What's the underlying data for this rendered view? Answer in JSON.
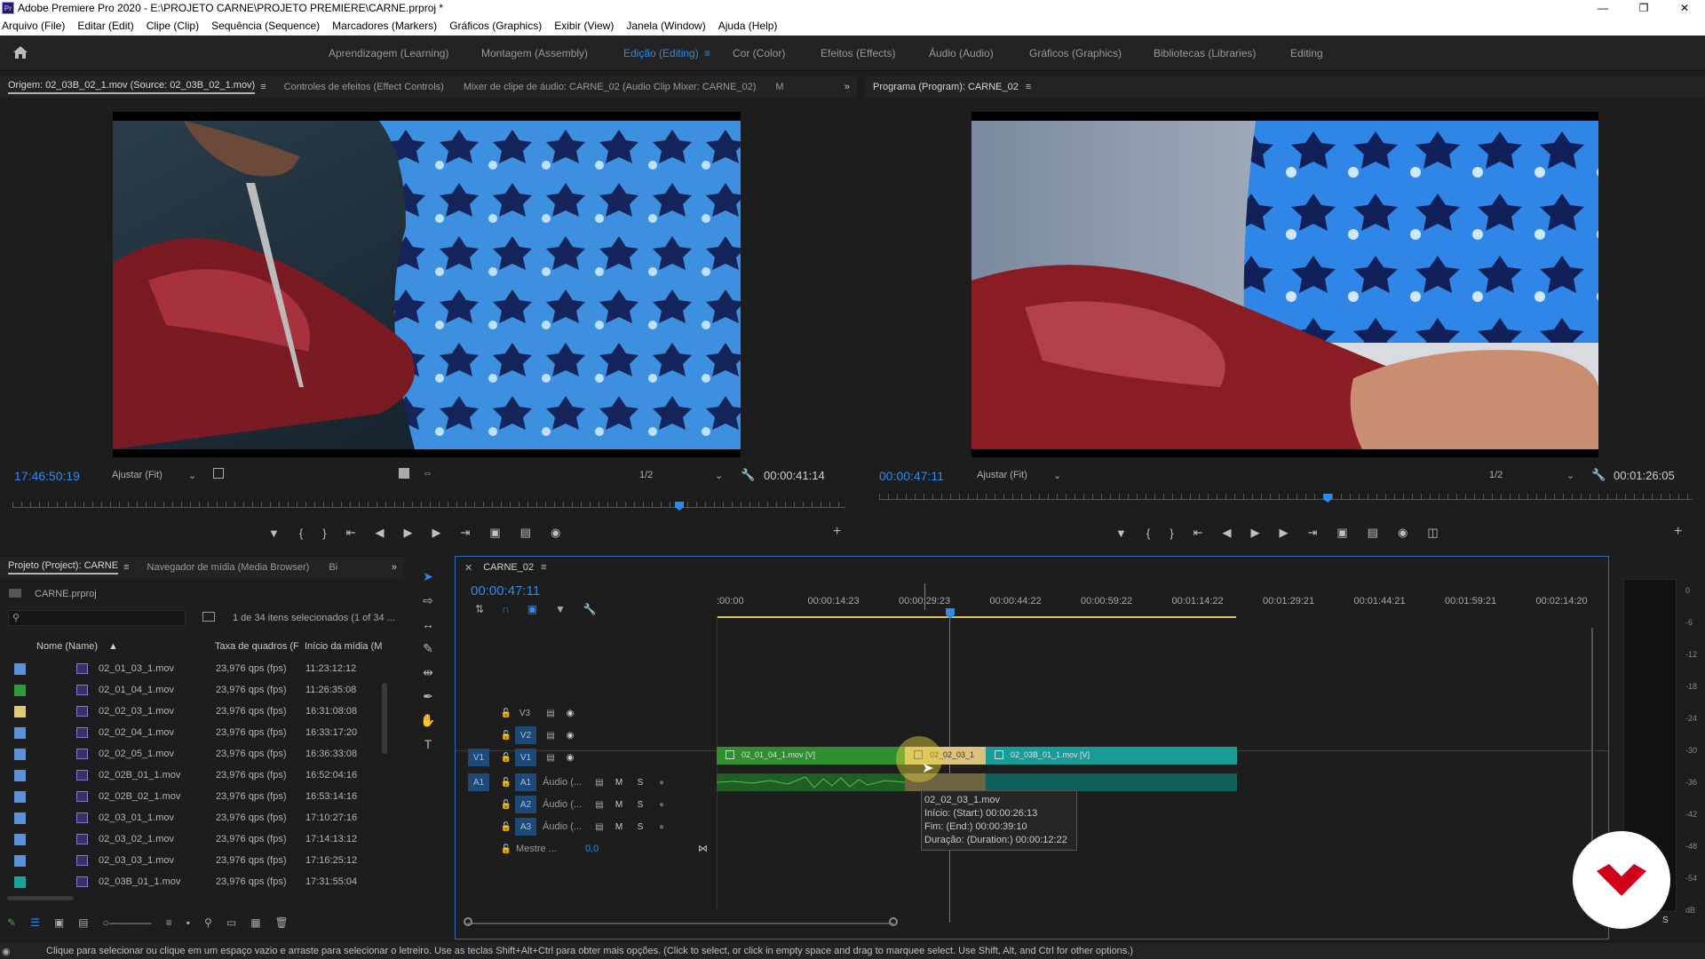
{
  "window": {
    "title": "Adobe Premiere Pro 2020 - E:\\PROJETO CARNE\\PROJETO PREMIERE\\CARNE.prproj *",
    "app_logo": "Pr"
  },
  "menu": [
    "Arquivo (File)",
    "Editar (Edit)",
    "Clipe (Clip)",
    "Sequência (Sequence)",
    "Marcadores (Markers)",
    "Gráficos (Graphics)",
    "Exibir (View)",
    "Janela (Window)",
    "Ajuda (Help)"
  ],
  "workspaces": [
    "Aprendizagem (Learning)",
    "Montagem (Assembly)",
    "Edição (Editing)",
    "Cor (Color)",
    "Efeitos (Effects)",
    "Áudio (Audio)",
    "Gráficos (Graphics)",
    "Bibliotecas (Libraries)",
    "Editing"
  ],
  "active_workspace": "Edição (Editing)",
  "source_panel": {
    "tabs": [
      "Origem: 02_03B_02_1.mov (Source: 02_03B_02_1.mov)",
      "Controles de efeitos (Effect Controls)",
      "Mixer de clipe de áudio: CARNE_02 (Audio Clip Mixer: CARNE_02)",
      "M"
    ],
    "timecode": "17:46:50:19",
    "fit": "Ajustar (Fit)",
    "resolution": "1/2",
    "duration": "00:00:41:14"
  },
  "program_panel": {
    "tab": "Programa (Program): CARNE_02",
    "timecode": "00:00:47:11",
    "fit": "Ajustar (Fit)",
    "resolution": "1/2",
    "duration": "00:01:26:05"
  },
  "project_panel": {
    "tabs": [
      "Projeto (Project): CARNE",
      "Navegador de mídia (Media Browser)",
      "Bi"
    ],
    "project_file": "CARNE.prproj",
    "selection_info": "1 de 34 itens selecionados (1 of 34 ...",
    "columns": [
      "Nome (Name)",
      "Taxa de quadros (F",
      "Início da mídia (M"
    ],
    "items": [
      {
        "color": "#5b8fd6",
        "name": "02_01_03_1.mov",
        "fps": "23,976 qps (fps)",
        "start": "11:23:12:12"
      },
      {
        "color": "#2f9a3a",
        "name": "02_01_04_1.mov",
        "fps": "23,976 qps (fps)",
        "start": "11:26:35:08"
      },
      {
        "color": "#e2c87a",
        "name": "02_02_03_1.mov",
        "fps": "23,976 qps (fps)",
        "start": "16:31:08:08"
      },
      {
        "color": "#5b8fd6",
        "name": "02_02_04_1.mov",
        "fps": "23,976 qps (fps)",
        "start": "16:33:17:20"
      },
      {
        "color": "#5b8fd6",
        "name": "02_02_05_1.mov",
        "fps": "23,976 qps (fps)",
        "start": "16:36:33:08"
      },
      {
        "color": "#5b8fd6",
        "name": "02_02B_01_1.mov",
        "fps": "23,976 qps (fps)",
        "start": "16:52:04:16"
      },
      {
        "color": "#5b8fd6",
        "name": "02_02B_02_1.mov",
        "fps": "23,976 qps (fps)",
        "start": "16:53:14:16"
      },
      {
        "color": "#5b8fd6",
        "name": "02_03_01_1.mov",
        "fps": "23,976 qps (fps)",
        "start": "17:10:27:16"
      },
      {
        "color": "#5b8fd6",
        "name": "02_03_02_1.mov",
        "fps": "23,976 qps (fps)",
        "start": "17:14:13:12"
      },
      {
        "color": "#5b8fd6",
        "name": "02_03_03_1.mov",
        "fps": "23,976 qps (fps)",
        "start": "17:16:25:12"
      },
      {
        "color": "#1aa39b",
        "name": "02_03B_01_1.mov",
        "fps": "23,976 qps (fps)",
        "start": "17:31:55:04"
      }
    ]
  },
  "timeline": {
    "tab": "CARNE_02",
    "timecode": "00:00:47:11",
    "ruler": [
      ":00:00",
      "00:00:14:23",
      "00:00:29:23",
      "00:00:44:22",
      "00:00:59:22",
      "00:01:14:22",
      "00:01:29:21",
      "00:01:44:21",
      "00:01:59:21",
      "00:02:14:20"
    ],
    "video_tracks": [
      "V3",
      "V2",
      "V1"
    ],
    "audio_tracks": [
      {
        "id": "A1",
        "name": "Áudio (...",
        "m": "M",
        "s": "S"
      },
      {
        "id": "A2",
        "name": "Áudio (...",
        "m": "M",
        "s": "S"
      },
      {
        "id": "A3",
        "name": "Áudio (...",
        "m": "M",
        "s": "S"
      }
    ],
    "source_target_v": "V1",
    "source_target_a": "A1",
    "master": {
      "label": "Mestre ...",
      "value": "0,0"
    },
    "clips": [
      {
        "name": "02_01_04_1.mov [V]",
        "color": "#2f8f2f"
      },
      {
        "name": "02_02_03_1",
        "color": "#d9c27c"
      },
      {
        "name": "02_03B_01_1.mov [V]",
        "color": "#1a9c96"
      }
    ],
    "tooltip": {
      "name": "02_02_03_1.mov",
      "start": "Início: (Start:) 00:00:26:13",
      "end": "Fim: (End:) 00:00:39:10",
      "duration": "Duração: (Duration:) 00:00:12:22"
    }
  },
  "meter": {
    "labels": [
      "0",
      "-6",
      "-12",
      "-18",
      "-24",
      "-30",
      "-36",
      "-42",
      "-48",
      "-54",
      "dB"
    ],
    "solo": "S"
  },
  "status_bar": "Clique para selecionar ou clique em um espaço vazio e arraste para selecionar o letreiro. Use as teclas Shift+Alt+Ctrl para obter mais opções. (Click to select, or click in empty space and drag to marquee select. Use Shift, Alt, and Ctrl for other options.)",
  "accent": "#2d8ceb"
}
